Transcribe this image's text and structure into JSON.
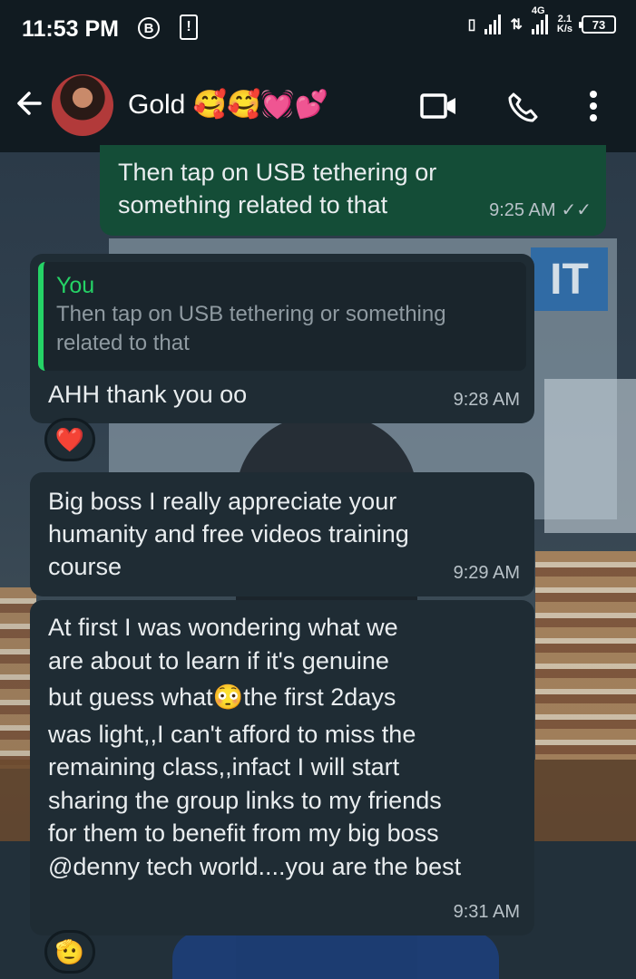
{
  "status_bar": {
    "time": "11:53 PM",
    "b_badge": "B",
    "alert_icon": "!",
    "network": "4G",
    "speed_top": "2.1",
    "speed_bottom": "K/s",
    "battery": "73"
  },
  "header": {
    "contact_name": "Gold 🥰🥰💓💕",
    "back_icon": "arrow-left-icon",
    "video_icon": "video-call-icon",
    "call_icon": "phone-icon",
    "menu_icon": "more-vertical-icon"
  },
  "wallpaper": {
    "sign_text": "IT"
  },
  "messages": [
    {
      "direction": "outgoing",
      "text_lines": [
        "Then tap on USB tethering or",
        "something related to that"
      ],
      "time": "9:25 AM",
      "status": "read"
    },
    {
      "direction": "incoming",
      "quote_author": "You",
      "quote_lines": [
        "Then tap on USB tethering or something",
        "related to that"
      ],
      "text": "AHH thank you oo",
      "time": "9:28 AM",
      "reaction": "❤️"
    },
    {
      "direction": "incoming",
      "text_lines": [
        "Big boss I really appreciate your",
        "humanity and free videos training",
        "course"
      ],
      "time": "9:29 AM"
    },
    {
      "direction": "incoming",
      "text_lines": [
        "At first I was wondering what we",
        "are about to learn if it's genuine",
        "but guess what😳the first 2days",
        "was light,,I can't afford to miss the",
        "remaining class,,infact I will start",
        "sharing the group links to my friends",
        "for them to benefit from my big boss",
        "@denny tech world....you are the best"
      ],
      "time": "9:31 AM",
      "reaction": "🫡"
    }
  ],
  "colors": {
    "background": "#111b21",
    "outgoing_bubble": "#144d37",
    "incoming_bubble": "#1f2c34",
    "quote_accent": "#25d366"
  }
}
